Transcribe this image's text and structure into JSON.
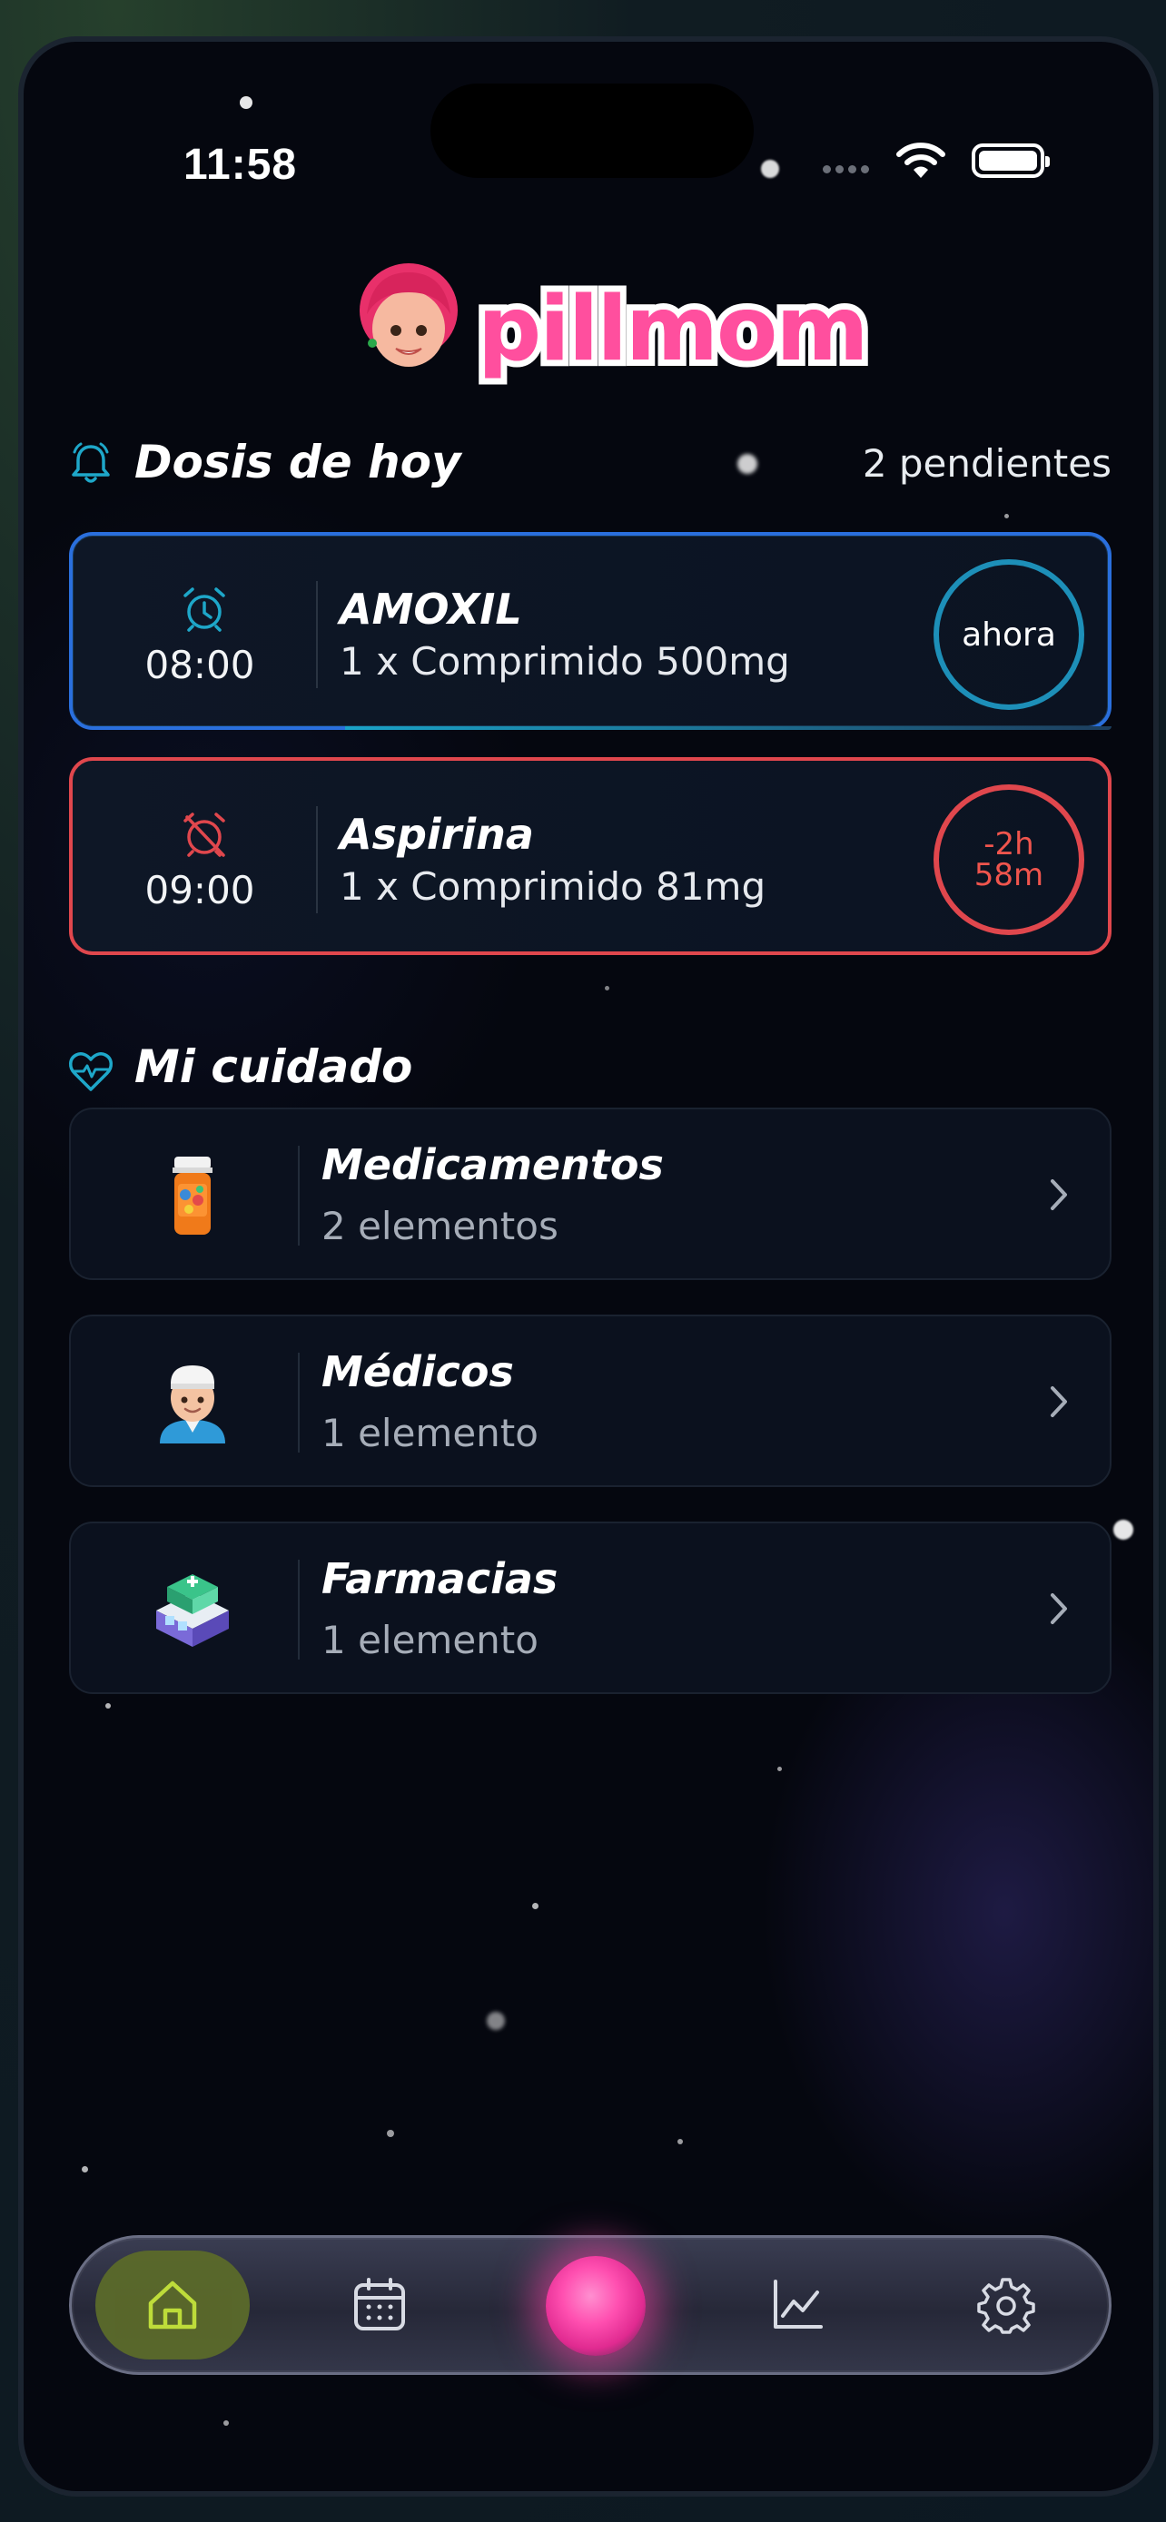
{
  "status_bar": {
    "time": "11:58"
  },
  "app": {
    "name": "pillmom"
  },
  "colors": {
    "accent_blue": "#1d8fb8",
    "alert_red": "#e0474d",
    "brand_pink": "#ff4f9e",
    "active_tab": "#5b6a2a"
  },
  "today": {
    "title": "Dosis de hoy",
    "pending": "2 pendientes",
    "doses": [
      {
        "time": "08:00",
        "name": "AMOXIL",
        "detail": "1 x Comprimido 500mg",
        "status": "ahora",
        "icon": "alarm-clock-icon",
        "state": "due"
      },
      {
        "time": "09:00",
        "name": "Aspirina",
        "detail": "1 x Comprimido 81mg",
        "status_line1": "-2h",
        "status_line2": "58m",
        "icon": "alarm-off-icon",
        "state": "overdue"
      }
    ]
  },
  "care": {
    "title": "Mi cuidado",
    "items": [
      {
        "title": "Medicamentos",
        "subtitle": "2 elementos",
        "icon": "pill-bottle-icon"
      },
      {
        "title": "Médicos",
        "subtitle": "1 elemento",
        "icon": "doctor-icon"
      },
      {
        "title": "Farmacias",
        "subtitle": "1 elemento",
        "icon": "pharmacy-icon"
      }
    ]
  },
  "tabbar": {
    "items": [
      "home-icon",
      "calendar-icon",
      "assistant-orb-icon",
      "chart-icon",
      "settings-icon"
    ],
    "active": "home-icon"
  }
}
